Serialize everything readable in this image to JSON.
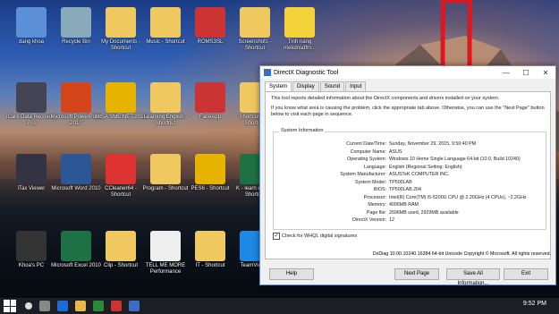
{
  "desktop_icons": [
    {
      "label": "dang khoa"
    },
    {
      "label": "Recycle Bin"
    },
    {
      "label": "My Documents - Shortcut"
    },
    {
      "label": "Music - Shortcut"
    },
    {
      "label": "ROMS3SL"
    },
    {
      "label": "Screenshots - Shortcut"
    },
    {
      "label": "Tinh nang ntekdnsdfm..."
    },
    {
      "label": "iCare Data Recovery Pro"
    },
    {
      "label": "Microsoft PowerPoint 2010"
    },
    {
      "label": "MISA SME.NET 2015"
    },
    {
      "label": "Learning English - Shortcut"
    },
    {
      "label": "FaceApp"
    },
    {
      "label": "Shortcut (2) - Shortcut"
    },
    {
      "label": "iTax Viewer"
    },
    {
      "label": "Microsoft Word 2010"
    },
    {
      "label": "CCleaner64 - Shortcut"
    },
    {
      "label": "Program - Shortcut"
    },
    {
      "label": "PES6 - Shortcut"
    },
    {
      "label": "K - learn excel - Shortcut"
    },
    {
      "label": "Khoa's PC"
    },
    {
      "label": "Microsoft Excel 2010"
    },
    {
      "label": "Clip - Shortcut"
    },
    {
      "label": "TELL ME MORE Performance"
    },
    {
      "label": "IT - Shortcut"
    },
    {
      "label": "TeamViewer"
    }
  ],
  "window": {
    "title": "DirectX Diagnostic Tool",
    "tabs": [
      "System",
      "Display",
      "Sound",
      "Input"
    ],
    "intro": "This tool reports detailed information about the DirectX components and drivers installed on your system.",
    "hint": "If you know what area is causing the problem, click the appropriate tab above. Otherwise, you can use the \"Next Page\" button below to visit each page in sequence.",
    "group_title": "System Information",
    "rows": [
      {
        "k": "Current Date/Time:",
        "v": "Sunday, November 29, 2015, 9:50:40 PM"
      },
      {
        "k": "Computer Name:",
        "v": "ASUS"
      },
      {
        "k": "Operating System:",
        "v": "Windows 10 Home Single Language 64-bit (10.0, Build 10240)"
      },
      {
        "k": "Language:",
        "v": "English (Regional Setting: English)"
      },
      {
        "k": "System Manufacturer:",
        "v": "ASUSTeK COMPUTER INC."
      },
      {
        "k": "System Model:",
        "v": "TP500LAB"
      },
      {
        "k": "BIOS:",
        "v": "TP500LAB.204"
      },
      {
        "k": "Processor:",
        "v": "Intel(R) Core(TM) i5-5200U CPU @ 2.20GHz (4 CPUs), ~2.2GHz"
      },
      {
        "k": "Memory:",
        "v": "4096MB RAM"
      },
      {
        "k": "Page file:",
        "v": "2696MB used, 2929MB available"
      },
      {
        "k": "DirectX Version:",
        "v": "12"
      }
    ],
    "checkbox_label": "Check for WHQL digital signatures",
    "footer": "DxDiag 10.00.10240.16384 64-bit Unicode Copyright © Microsoft. All rights reserved.",
    "buttons": {
      "help": "Help",
      "next": "Next Page",
      "save": "Save All Information...",
      "exit": "Exit"
    }
  },
  "taskbar": {
    "time": "9:52 PM"
  }
}
